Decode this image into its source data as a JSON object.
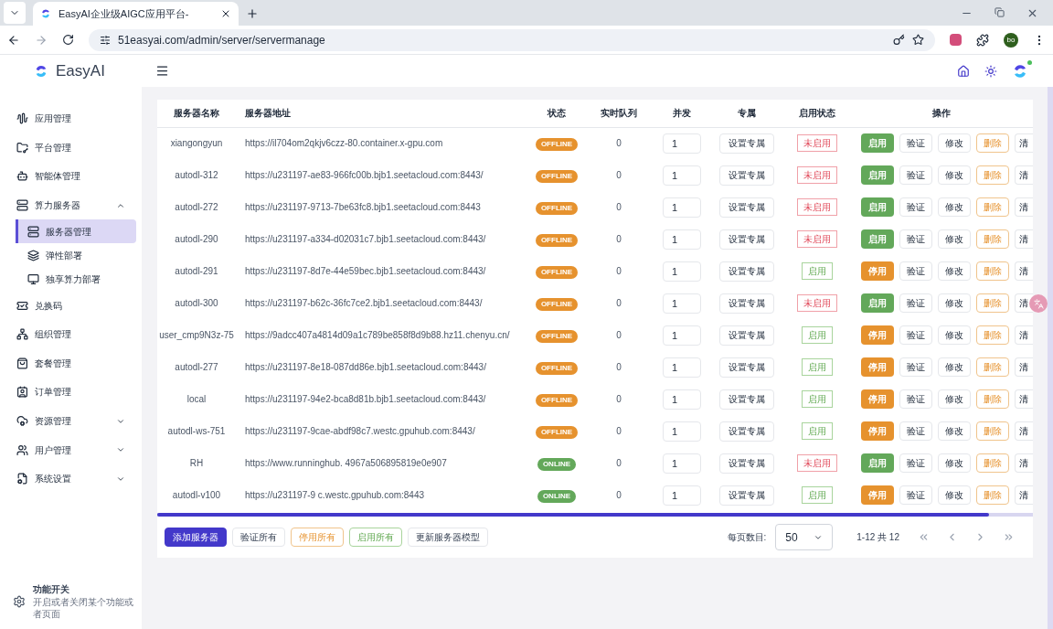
{
  "browser": {
    "tab_title": "EasyAI企业级AIGC应用平台-",
    "url": "51easyai.com/admin/server/servermanage",
    "profile": "bo"
  },
  "sidebar": {
    "logo": "EasyAI",
    "items": [
      {
        "label": "应用管理"
      },
      {
        "label": "平台管理"
      },
      {
        "label": "智能体管理"
      },
      {
        "label": "算力服务器",
        "expanded": true,
        "children": [
          {
            "label": "服务器管理",
            "selected": true
          },
          {
            "label": "弹性部署",
            "selected": false
          },
          {
            "label": "独享算力部署",
            "selected": false
          }
        ]
      },
      {
        "label": "兑换码"
      },
      {
        "label": "组织管理"
      },
      {
        "label": "套餐管理"
      },
      {
        "label": "订单管理"
      },
      {
        "label": "资源管理",
        "expanded": false
      },
      {
        "label": "用户管理",
        "expanded": false
      },
      {
        "label": "系统设置",
        "expanded": false
      }
    ],
    "footer": {
      "title": "功能开关",
      "description": "开启或者关闭某个功能或者页面"
    }
  },
  "table": {
    "columns": [
      "服务器名称",
      "服务器地址",
      "状态",
      "实时队列",
      "并发",
      "专属",
      "启用状态",
      "操作"
    ],
    "rows": [
      {
        "name": "xiangongyun",
        "url": "https://il704om2qkjv6czz-80.container.x-gpu.com",
        "status": "OFFLINE",
        "online": false,
        "queue": "0",
        "concurrency": "1",
        "exclusive": "设置专属",
        "enabled": false,
        "enabled_label": "未启用",
        "toggle": "启用",
        "verify": "验证",
        "edit": "修改",
        "delete": "删除",
        "clear": "清"
      },
      {
        "name": "autodl-312",
        "url": "https://u231197-ae83-966fc00b.bjb1.seetacloud.com:8443/",
        "status": "OFFLINE",
        "online": false,
        "queue": "0",
        "concurrency": "1",
        "exclusive": "设置专属",
        "enabled": false,
        "enabled_label": "未启用",
        "toggle": "启用",
        "verify": "验证",
        "edit": "修改",
        "delete": "删除",
        "clear": "清"
      },
      {
        "name": "autodl-272",
        "url": "https://u231197-9713-7be63fc8.bjb1.seetacloud.com:8443",
        "status": "OFFLINE",
        "online": false,
        "queue": "0",
        "concurrency": "1",
        "exclusive": "设置专属",
        "enabled": false,
        "enabled_label": "未启用",
        "toggle": "启用",
        "verify": "验证",
        "edit": "修改",
        "delete": "删除",
        "clear": "清"
      },
      {
        "name": "autodl-290",
        "url": "https://u231197-a334-d02031c7.bjb1.seetacloud.com:8443/",
        "status": "OFFLINE",
        "online": false,
        "queue": "0",
        "concurrency": "1",
        "exclusive": "设置专属",
        "enabled": false,
        "enabled_label": "未启用",
        "toggle": "启用",
        "verify": "验证",
        "edit": "修改",
        "delete": "删除",
        "clear": "清"
      },
      {
        "name": "autodl-291",
        "url": "https://u231197-8d7e-44e59bec.bjb1.seetacloud.com:8443/",
        "status": "OFFLINE",
        "online": false,
        "queue": "0",
        "concurrency": "1",
        "exclusive": "设置专属",
        "enabled": true,
        "enabled_label": "启用",
        "toggle": "停用",
        "verify": "验证",
        "edit": "修改",
        "delete": "删除",
        "clear": "清"
      },
      {
        "name": "autodl-300",
        "url": "https://u231197-b62c-36fc7ce2.bjb1.seetacloud.com:8443/",
        "status": "OFFLINE",
        "online": false,
        "queue": "0",
        "concurrency": "1",
        "exclusive": "设置专属",
        "enabled": false,
        "enabled_label": "未启用",
        "toggle": "启用",
        "verify": "验证",
        "edit": "修改",
        "delete": "删除",
        "clear": "清"
      },
      {
        "name": "user_cmp9N3z-75",
        "url": "https://9adcc407a4814d09a1c789be858f8d9b88.hz11.chenyu.cn/",
        "status": "OFFLINE",
        "online": false,
        "queue": "0",
        "concurrency": "1",
        "exclusive": "设置专属",
        "enabled": true,
        "enabled_label": "启用",
        "toggle": "停用",
        "verify": "验证",
        "edit": "修改",
        "delete": "删除",
        "clear": "清"
      },
      {
        "name": "autodl-277",
        "url": "https://u231197-8e18-087dd86e.bjb1.seetacloud.com:8443/",
        "status": "OFFLINE",
        "online": false,
        "queue": "0",
        "concurrency": "1",
        "exclusive": "设置专属",
        "enabled": true,
        "enabled_label": "启用",
        "toggle": "停用",
        "verify": "验证",
        "edit": "修改",
        "delete": "删除",
        "clear": "清"
      },
      {
        "name": "local",
        "url": "https://u231197-94e2-bca8d81b.bjb1.seetacloud.com:8443/",
        "status": "OFFLINE",
        "online": false,
        "queue": "0",
        "concurrency": "1",
        "exclusive": "设置专属",
        "enabled": true,
        "enabled_label": "启用",
        "toggle": "停用",
        "verify": "验证",
        "edit": "修改",
        "delete": "删除",
        "clear": "清"
      },
      {
        "name": "autodl-ws-751",
        "url": "https://u231197-9cae-abdf98c7.westc.gpuhub.com:8443/",
        "status": "OFFLINE",
        "online": false,
        "queue": "0",
        "concurrency": "1",
        "exclusive": "设置专属",
        "enabled": true,
        "enabled_label": "启用",
        "toggle": "停用",
        "verify": "验证",
        "edit": "修改",
        "delete": "删除",
        "clear": "清"
      },
      {
        "name": "RH",
        "url": "https://www.runninghub. 4967a506895819e0e907",
        "status": "ONLINE",
        "online": true,
        "queue": "0",
        "concurrency": "1",
        "exclusive": "设置专属",
        "enabled": false,
        "enabled_label": "未启用",
        "toggle": "启用",
        "verify": "验证",
        "edit": "修改",
        "delete": "删除",
        "clear": "清"
      },
      {
        "name": "autodl-v100",
        "url": "https://u231197-9 c.westc.gpuhub.com:8443",
        "status": "ONLINE",
        "online": true,
        "queue": "0",
        "concurrency": "1",
        "exclusive": "设置专属",
        "enabled": true,
        "enabled_label": "启用",
        "toggle": "停用",
        "verify": "验证",
        "edit": "修改",
        "delete": "删除",
        "clear": "清"
      }
    ]
  },
  "footer_buttons": [
    {
      "kind": "primary",
      "label": "添加服务器"
    },
    {
      "kind": "default",
      "label": "验证所有"
    },
    {
      "kind": "warning",
      "label": "停用所有"
    },
    {
      "kind": "success",
      "label": "启用所有"
    },
    {
      "kind": "default",
      "label": "更新服务器模型"
    }
  ],
  "pagination": {
    "page_size_label": "每页数目:",
    "page_size": "50",
    "range": "1-12 共 12"
  }
}
